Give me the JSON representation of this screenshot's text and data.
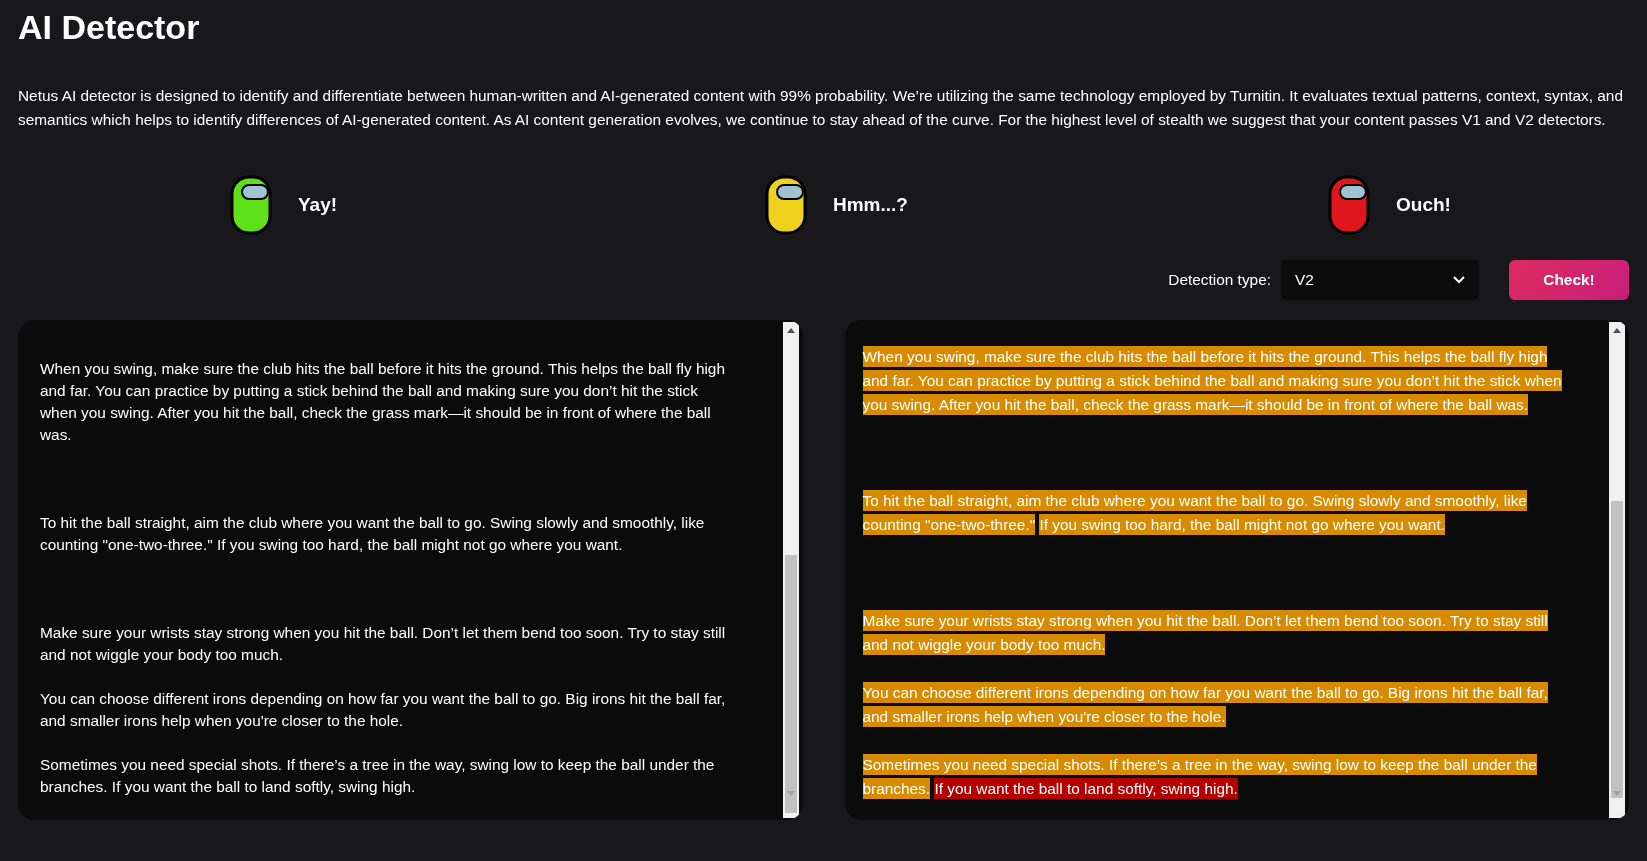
{
  "title": "AI Detector",
  "description": "Netus AI detector is designed to identify and differentiate between human-written and AI-generated content with 99% probability. We’re utilizing the same technology employed by Turnitin. It evaluates textual patterns, context, syntax, and semantics which helps to identify differences of AI-generated content. As AI content generation evolves, we continue to stay ahead of the curve. For the highest level of stealth we suggest that your content passes V1 and V2 detectors.",
  "legend": [
    {
      "label": "Yay!",
      "color": "#5fe11a"
    },
    {
      "label": "Hmm...?",
      "color": "#f0d21e"
    },
    {
      "label": "Ouch!",
      "color": "#e0161e"
    }
  ],
  "detection_type": {
    "label": "Detection type:",
    "value": "V2"
  },
  "check_button": "Check!",
  "input_text": [
    [
      "When you swing, make sure the club hits the ball before it hits the ground. This helps the ball fly high",
      "and far. You can practice by putting a stick behind the ball and making sure you don’t hit the stick",
      "when you swing. After you hit the ball, check the grass mark—it should be in front of where the ball",
      "was."
    ],
    [
      "To hit the ball straight, aim the club where you want the ball to go. Swing slowly and smoothly, like",
      "counting \"one-two-three.\" If you swing too hard, the ball might not go where you want."
    ],
    [
      "Make sure your wrists stay strong when you hit the ball. Don’t let them bend too soon. Try to stay still",
      "and not wiggle your body too much."
    ],
    [
      "You can choose different irons depending on how far you want the ball to go. Big irons hit the ball far,",
      "and smaller irons help when you're closer to the hole."
    ],
    [
      "Sometimes you need special shots. If there’s a tree in the way, swing low to keep the ball under the",
      "branches. If you want the ball to land softly, swing high."
    ]
  ],
  "result_text": [
    [
      {
        "lines": [
          "When you swing, make sure the club hits the ball before it hits the ground. This helps the ball fly high",
          "and far. You can practice by putting a stick behind the ball and making sure you don’t hit the stick when",
          "you swing. After you hit the ball, check the grass mark—it should be in front of where the ball was."
        ],
        "color": "#d68b00"
      }
    ],
    [
      {
        "lines": [
          "To hit the ball straight, aim the club where you want the ball to go. Swing slowly and smoothly, like",
          "counting \"one-two-three.\""
        ],
        "color": "#d68b00"
      },
      {
        "lines": [
          "If you swing too hard, the ball might not go where you want."
        ],
        "color": "#d68b00"
      }
    ],
    [
      {
        "lines": [
          "Make sure your wrists stay strong when you hit the ball. Don’t let them bend too soon. Try to stay still",
          "and not wiggle your body too much."
        ],
        "color": "#d68b00"
      }
    ],
    [
      {
        "lines": [
          "You can choose different irons depending on how far you want the ball to go. Big irons hit the ball far,",
          "and smaller irons help when you're closer to the hole."
        ],
        "color": "#d68b00"
      }
    ],
    [
      {
        "lines": [
          "Sometimes you need special shots. If there’s a tree in the way, swing low to keep the ball under the",
          "branches."
        ],
        "color": "#d68b00"
      },
      {
        "lines": [
          "If you want the ball to land softly, swing high."
        ],
        "color": "#b50000"
      }
    ]
  ]
}
